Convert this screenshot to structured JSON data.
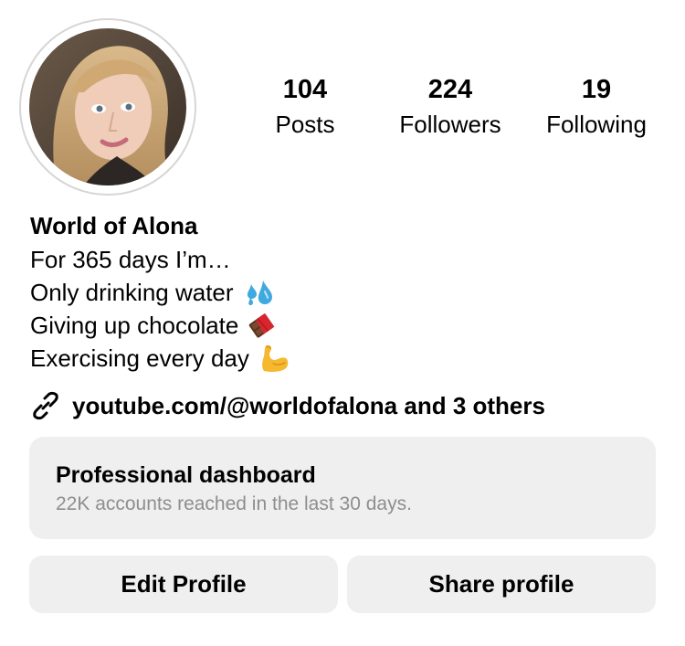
{
  "profile": {
    "avatar_alt": "profile photo",
    "display_name": "World of Alona"
  },
  "stats": [
    {
      "value": "104",
      "label": "Posts"
    },
    {
      "value": "224",
      "label": "Followers"
    },
    {
      "value": "19",
      "label": "Following"
    }
  ],
  "bio": {
    "lines": [
      {
        "text": "For 365 days I’m…",
        "icon": ""
      },
      {
        "text": "Only drinking water",
        "icon": "water-droplets-icon"
      },
      {
        "text": "Giving up chocolate",
        "icon": "chocolate-bar-icon"
      },
      {
        "text": "Exercising every day",
        "icon": "flexed-biceps-icon"
      }
    ]
  },
  "links": {
    "icon": "link-icon",
    "text": "youtube.com/@worldofalona and 3 others"
  },
  "dashboard": {
    "title": "Professional dashboard",
    "subtitle": "22K accounts reached in the last 30 days."
  },
  "buttons": {
    "edit_label": "Edit Profile",
    "share_label": "Share profile"
  },
  "colors": {
    "button_bg": "#efefef",
    "muted_text": "#8e8e8e",
    "avatar_ring": "#d6d6d6"
  }
}
